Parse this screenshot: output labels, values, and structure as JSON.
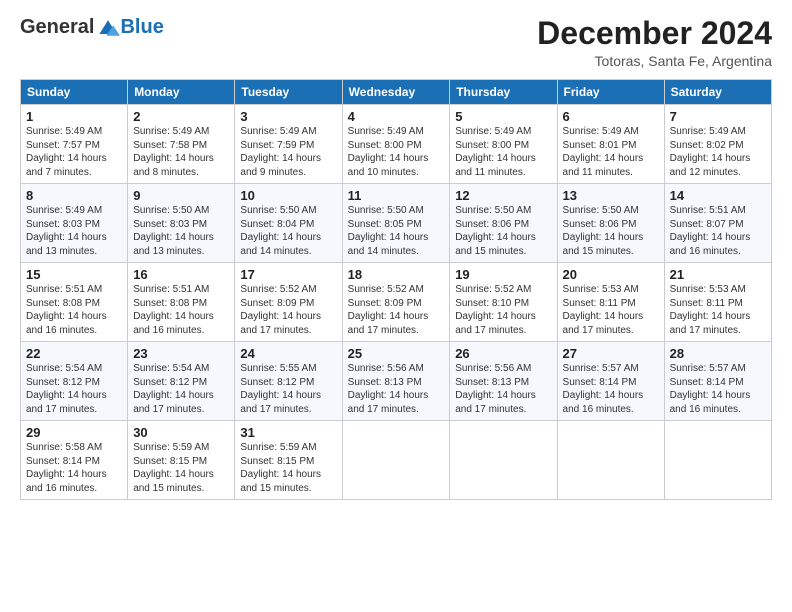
{
  "logo": {
    "general": "General",
    "blue": "Blue"
  },
  "header": {
    "month": "December 2024",
    "location": "Totoras, Santa Fe, Argentina"
  },
  "weekdays": [
    "Sunday",
    "Monday",
    "Tuesday",
    "Wednesday",
    "Thursday",
    "Friday",
    "Saturday"
  ],
  "weeks": [
    [
      {
        "day": "1",
        "info": "Sunrise: 5:49 AM\nSunset: 7:57 PM\nDaylight: 14 hours and 7 minutes."
      },
      {
        "day": "2",
        "info": "Sunrise: 5:49 AM\nSunset: 7:58 PM\nDaylight: 14 hours and 8 minutes."
      },
      {
        "day": "3",
        "info": "Sunrise: 5:49 AM\nSunset: 7:59 PM\nDaylight: 14 hours and 9 minutes."
      },
      {
        "day": "4",
        "info": "Sunrise: 5:49 AM\nSunset: 8:00 PM\nDaylight: 14 hours and 10 minutes."
      },
      {
        "day": "5",
        "info": "Sunrise: 5:49 AM\nSunset: 8:00 PM\nDaylight: 14 hours and 11 minutes."
      },
      {
        "day": "6",
        "info": "Sunrise: 5:49 AM\nSunset: 8:01 PM\nDaylight: 14 hours and 11 minutes."
      },
      {
        "day": "7",
        "info": "Sunrise: 5:49 AM\nSunset: 8:02 PM\nDaylight: 14 hours and 12 minutes."
      }
    ],
    [
      {
        "day": "8",
        "info": "Sunrise: 5:49 AM\nSunset: 8:03 PM\nDaylight: 14 hours and 13 minutes."
      },
      {
        "day": "9",
        "info": "Sunrise: 5:50 AM\nSunset: 8:03 PM\nDaylight: 14 hours and 13 minutes."
      },
      {
        "day": "10",
        "info": "Sunrise: 5:50 AM\nSunset: 8:04 PM\nDaylight: 14 hours and 14 minutes."
      },
      {
        "day": "11",
        "info": "Sunrise: 5:50 AM\nSunset: 8:05 PM\nDaylight: 14 hours and 14 minutes."
      },
      {
        "day": "12",
        "info": "Sunrise: 5:50 AM\nSunset: 8:06 PM\nDaylight: 14 hours and 15 minutes."
      },
      {
        "day": "13",
        "info": "Sunrise: 5:50 AM\nSunset: 8:06 PM\nDaylight: 14 hours and 15 minutes."
      },
      {
        "day": "14",
        "info": "Sunrise: 5:51 AM\nSunset: 8:07 PM\nDaylight: 14 hours and 16 minutes."
      }
    ],
    [
      {
        "day": "15",
        "info": "Sunrise: 5:51 AM\nSunset: 8:08 PM\nDaylight: 14 hours and 16 minutes."
      },
      {
        "day": "16",
        "info": "Sunrise: 5:51 AM\nSunset: 8:08 PM\nDaylight: 14 hours and 16 minutes."
      },
      {
        "day": "17",
        "info": "Sunrise: 5:52 AM\nSunset: 8:09 PM\nDaylight: 14 hours and 17 minutes."
      },
      {
        "day": "18",
        "info": "Sunrise: 5:52 AM\nSunset: 8:09 PM\nDaylight: 14 hours and 17 minutes."
      },
      {
        "day": "19",
        "info": "Sunrise: 5:52 AM\nSunset: 8:10 PM\nDaylight: 14 hours and 17 minutes."
      },
      {
        "day": "20",
        "info": "Sunrise: 5:53 AM\nSunset: 8:11 PM\nDaylight: 14 hours and 17 minutes."
      },
      {
        "day": "21",
        "info": "Sunrise: 5:53 AM\nSunset: 8:11 PM\nDaylight: 14 hours and 17 minutes."
      }
    ],
    [
      {
        "day": "22",
        "info": "Sunrise: 5:54 AM\nSunset: 8:12 PM\nDaylight: 14 hours and 17 minutes."
      },
      {
        "day": "23",
        "info": "Sunrise: 5:54 AM\nSunset: 8:12 PM\nDaylight: 14 hours and 17 minutes."
      },
      {
        "day": "24",
        "info": "Sunrise: 5:55 AM\nSunset: 8:12 PM\nDaylight: 14 hours and 17 minutes."
      },
      {
        "day": "25",
        "info": "Sunrise: 5:56 AM\nSunset: 8:13 PM\nDaylight: 14 hours and 17 minutes."
      },
      {
        "day": "26",
        "info": "Sunrise: 5:56 AM\nSunset: 8:13 PM\nDaylight: 14 hours and 17 minutes."
      },
      {
        "day": "27",
        "info": "Sunrise: 5:57 AM\nSunset: 8:14 PM\nDaylight: 14 hours and 16 minutes."
      },
      {
        "day": "28",
        "info": "Sunrise: 5:57 AM\nSunset: 8:14 PM\nDaylight: 14 hours and 16 minutes."
      }
    ],
    [
      {
        "day": "29",
        "info": "Sunrise: 5:58 AM\nSunset: 8:14 PM\nDaylight: 14 hours and 16 minutes."
      },
      {
        "day": "30",
        "info": "Sunrise: 5:59 AM\nSunset: 8:15 PM\nDaylight: 14 hours and 15 minutes."
      },
      {
        "day": "31",
        "info": "Sunrise: 5:59 AM\nSunset: 8:15 PM\nDaylight: 14 hours and 15 minutes."
      },
      null,
      null,
      null,
      null
    ]
  ]
}
